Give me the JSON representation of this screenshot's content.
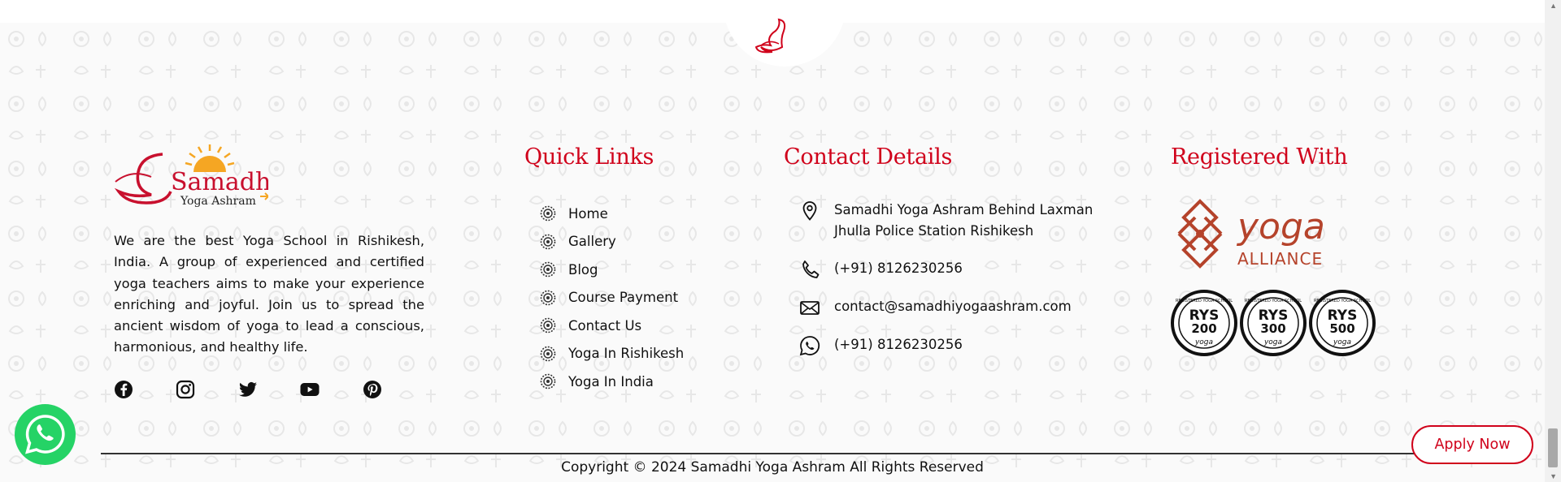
{
  "colors": {
    "accent": "#d0021b",
    "whatsapp": "#25d366",
    "text": "#111111",
    "background": "#fafafa"
  },
  "logo": {
    "brand": "Samadhi",
    "sub": "Yoga Ashram",
    "icon": "swan-sun-logo"
  },
  "about": {
    "text": "We are the best Yoga School in Rishikesh, India. A group of experienced and certified yoga teachers aims to make your experience enriching and joyful. Join us to spread the ancient wisdom of yoga to lead a conscious, harmonious, and healthy life."
  },
  "social": [
    {
      "icon": "facebook-icon"
    },
    {
      "icon": "instagram-icon"
    },
    {
      "icon": "twitter-icon"
    },
    {
      "icon": "youtube-icon"
    },
    {
      "icon": "pinterest-icon"
    }
  ],
  "quick_links": {
    "title": "Quick Links",
    "items": [
      {
        "label": "Home"
      },
      {
        "label": "Gallery"
      },
      {
        "label": "Blog"
      },
      {
        "label": "Course Payment"
      },
      {
        "label": "Contact Us"
      },
      {
        "label": "Yoga In Rishikesh"
      },
      {
        "label": "Yoga In India"
      }
    ]
  },
  "contact": {
    "title": "Contact Details",
    "address_line1": "Samadhi Yoga Ashram Behind Laxman",
    "address_line2": "Jhulla Police Station Rishikesh",
    "phone": "(+91) 8126230256",
    "email": "contact@samadhiyogaashram.com",
    "whatsapp": "(+91) 8126230256"
  },
  "registered": {
    "title": "Registered With",
    "alliance_top": "yoga",
    "alliance_bottom": "ALLIANCE",
    "badges": [
      {
        "code": "RYS",
        "level": "200"
      },
      {
        "code": "RYS",
        "level": "300"
      },
      {
        "code": "RYS",
        "level": "500"
      }
    ],
    "badge_ring": "REGISTERED YOGA SCHOOL",
    "badge_sub": "yoga"
  },
  "cta": {
    "apply": "Apply Now"
  },
  "copyright": "Copyright © 2024 Samadhi Yoga Ashram All Rights Reserved"
}
